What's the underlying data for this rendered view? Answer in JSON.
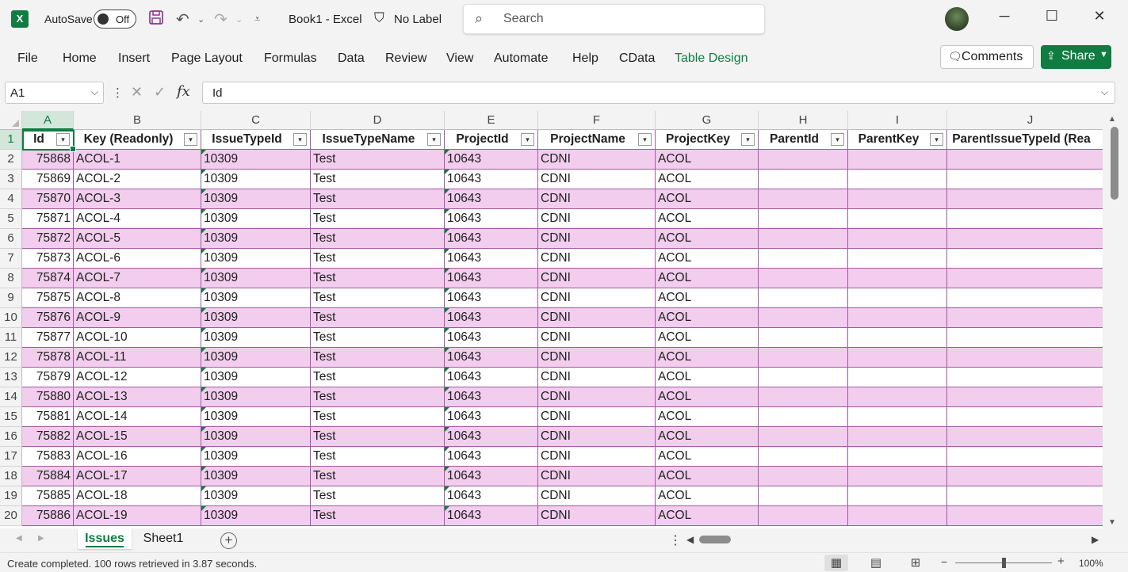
{
  "titlebar": {
    "autosave_label": "AutoSave",
    "autosave_state": "Off",
    "document_title": "Book1  -  Excel",
    "sensitivity_label": "No Label",
    "search_placeholder": "Search"
  },
  "ribbon": {
    "tabs": [
      "File",
      "Home",
      "Insert",
      "Page Layout",
      "Formulas",
      "Data",
      "Review",
      "View",
      "Automate",
      "Help",
      "CData",
      "Table Design"
    ],
    "active_tab": "Table Design",
    "comments_label": "Comments",
    "share_label": "Share"
  },
  "formula_bar": {
    "name_box": "A1",
    "fx": "fx",
    "formula": "Id"
  },
  "grid": {
    "column_letters": [
      "A",
      "B",
      "C",
      "D",
      "E",
      "F",
      "G",
      "H",
      "I",
      "J"
    ],
    "headers": [
      "Id",
      "Key (Readonly)",
      "IssueTypeId",
      "IssueTypeName",
      "ProjectId",
      "ProjectName",
      "ProjectKey",
      "ParentId",
      "ParentKey",
      "ParentIssueTypeId (Rea"
    ],
    "row_numbers": [
      "1",
      "2",
      "3",
      "4",
      "5",
      "6",
      "7",
      "8",
      "9",
      "10",
      "11",
      "12",
      "13",
      "14",
      "15",
      "16",
      "17",
      "18",
      "19",
      "20"
    ],
    "rows": [
      [
        "75868",
        "ACOL-1",
        "10309",
        "Test",
        "10643",
        "CDNI",
        "ACOL",
        "",
        "",
        ""
      ],
      [
        "75869",
        "ACOL-2",
        "10309",
        "Test",
        "10643",
        "CDNI",
        "ACOL",
        "",
        "",
        ""
      ],
      [
        "75870",
        "ACOL-3",
        "10309",
        "Test",
        "10643",
        "CDNI",
        "ACOL",
        "",
        "",
        ""
      ],
      [
        "75871",
        "ACOL-4",
        "10309",
        "Test",
        "10643",
        "CDNI",
        "ACOL",
        "",
        "",
        ""
      ],
      [
        "75872",
        "ACOL-5",
        "10309",
        "Test",
        "10643",
        "CDNI",
        "ACOL",
        "",
        "",
        ""
      ],
      [
        "75873",
        "ACOL-6",
        "10309",
        "Test",
        "10643",
        "CDNI",
        "ACOL",
        "",
        "",
        ""
      ],
      [
        "75874",
        "ACOL-7",
        "10309",
        "Test",
        "10643",
        "CDNI",
        "ACOL",
        "",
        "",
        ""
      ],
      [
        "75875",
        "ACOL-8",
        "10309",
        "Test",
        "10643",
        "CDNI",
        "ACOL",
        "",
        "",
        ""
      ],
      [
        "75876",
        "ACOL-9",
        "10309",
        "Test",
        "10643",
        "CDNI",
        "ACOL",
        "",
        "",
        ""
      ],
      [
        "75877",
        "ACOL-10",
        "10309",
        "Test",
        "10643",
        "CDNI",
        "ACOL",
        "",
        "",
        ""
      ],
      [
        "75878",
        "ACOL-11",
        "10309",
        "Test",
        "10643",
        "CDNI",
        "ACOL",
        "",
        "",
        ""
      ],
      [
        "75879",
        "ACOL-12",
        "10309",
        "Test",
        "10643",
        "CDNI",
        "ACOL",
        "",
        "",
        ""
      ],
      [
        "75880",
        "ACOL-13",
        "10309",
        "Test",
        "10643",
        "CDNI",
        "ACOL",
        "",
        "",
        ""
      ],
      [
        "75881",
        "ACOL-14",
        "10309",
        "Test",
        "10643",
        "CDNI",
        "ACOL",
        "",
        "",
        ""
      ],
      [
        "75882",
        "ACOL-15",
        "10309",
        "Test",
        "10643",
        "CDNI",
        "ACOL",
        "",
        "",
        ""
      ],
      [
        "75883",
        "ACOL-16",
        "10309",
        "Test",
        "10643",
        "CDNI",
        "ACOL",
        "",
        "",
        ""
      ],
      [
        "75884",
        "ACOL-17",
        "10309",
        "Test",
        "10643",
        "CDNI",
        "ACOL",
        "",
        "",
        ""
      ],
      [
        "75885",
        "ACOL-18",
        "10309",
        "Test",
        "10643",
        "CDNI",
        "ACOL",
        "",
        "",
        ""
      ],
      [
        "75886",
        "ACOL-19",
        "10309",
        "Test",
        "10643",
        "CDNI",
        "ACOL",
        "",
        "",
        ""
      ]
    ]
  },
  "sheets": {
    "tabs": [
      "Issues",
      "Sheet1"
    ],
    "active": "Issues"
  },
  "status": {
    "message": "Create completed. 100 rows retrieved in 3.87 seconds.",
    "zoom": "100%"
  },
  "colors": {
    "accent": "#107c41",
    "band": "#f2cdee",
    "table_border": "#a05ca0"
  }
}
